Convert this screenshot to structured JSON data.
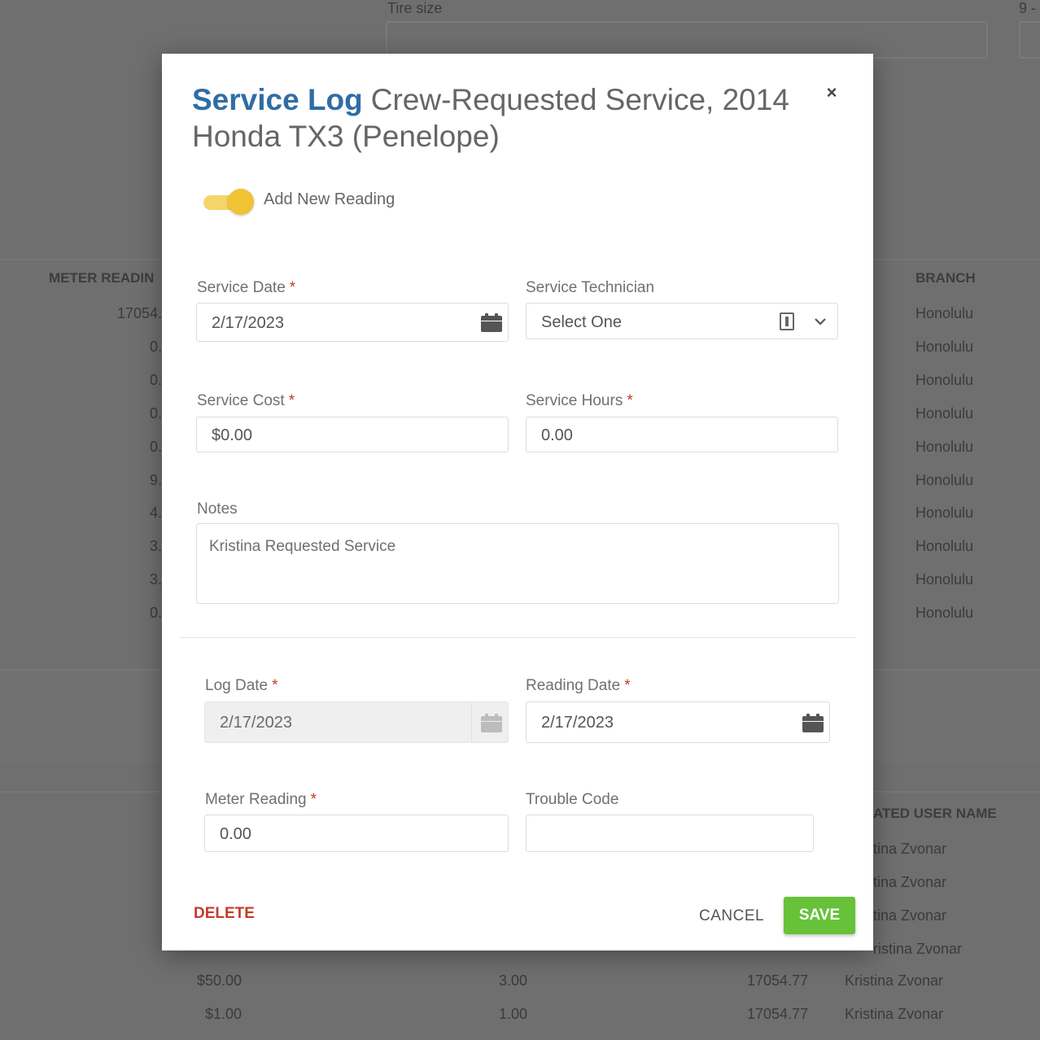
{
  "background": {
    "tire_size_label": "Tire size",
    "tire_size_suffix": "9 -",
    "top_headers": {
      "meter_reading": "METER READIN",
      "branch": "BRANCH"
    },
    "meter_values": [
      "17054.",
      "0.",
      "0.",
      "0.",
      "0.",
      "9.",
      "4.",
      "3.",
      "3.",
      "0."
    ],
    "branch_values": [
      "Honolulu",
      "Honolulu",
      "Honolulu",
      "Honolulu",
      "Honolulu",
      "Honolulu",
      "Honolulu",
      "Honolulu",
      "Honolulu",
      "Honolulu"
    ],
    "bottom_header": "ATED USER NAME",
    "user_values": [
      "tina Zvonar",
      "tina Zvonar",
      "tina Zvonar",
      "ristina Zvonar"
    ],
    "bottom_rows": [
      {
        "cost": "$50.00",
        "hours": "3.00",
        "reading": "17054.77",
        "user": "Kristina Zvonar"
      },
      {
        "cost": "$1.00",
        "hours": "1.00",
        "reading": "17054.77",
        "user": "Kristina Zvonar"
      }
    ]
  },
  "modal": {
    "title_brand": "Service Log",
    "title_text": "Crew-Requested Service, 2014 Honda TX3 (Penelope)",
    "toggle_label": "Add New Reading",
    "required_mark": "*",
    "service_date": {
      "label": "Service Date",
      "value": "2/17/2023"
    },
    "service_technician": {
      "label": "Service Technician",
      "value": "Select One"
    },
    "service_cost": {
      "label": "Service Cost",
      "value": "$0.00"
    },
    "service_hours": {
      "label": "Service Hours",
      "value": "0.00"
    },
    "notes": {
      "label": "Notes",
      "value": "Kristina Requested Service"
    },
    "log_date": {
      "label": "Log Date",
      "value": "2/17/2023"
    },
    "reading_date": {
      "label": "Reading Date",
      "value": "2/17/2023"
    },
    "meter_reading": {
      "label": "Meter Reading",
      "value": "0.00"
    },
    "trouble_code": {
      "label": "Trouble Code",
      "value": ""
    },
    "delete_label": "DELETE",
    "cancel_label": "CANCEL",
    "save_label": "SAVE"
  },
  "colors": {
    "brand": "#2f6da5",
    "save": "#67c23a",
    "delete": "#c73a2a",
    "toggle": "#f1c232"
  }
}
